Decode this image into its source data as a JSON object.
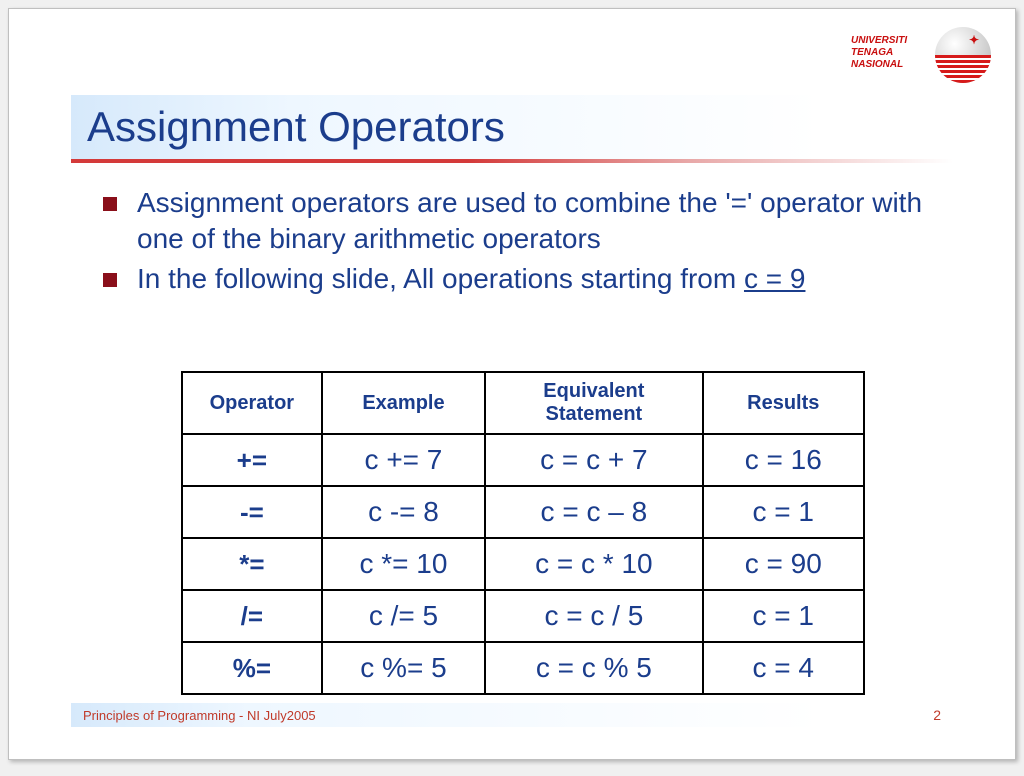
{
  "logo": {
    "line1": "UNIVERSITI",
    "line2": "TENAGA",
    "line3": "NASIONAL"
  },
  "title": "Assignment Operators",
  "bullets": [
    {
      "text": "Assignment operators are used to combine the '=' operator with one of the binary arithmetic operators"
    },
    {
      "text": "In the following slide, All operations starting from ",
      "tail_underlined": "c = 9"
    }
  ],
  "table": {
    "headers": [
      "Operator",
      "Example",
      "Equivalent Statement",
      "Results"
    ],
    "rows": [
      {
        "operator": "+=",
        "example": "c += 7",
        "equivalent": "c = c + 7",
        "result": "c = 16"
      },
      {
        "operator": "-=",
        "example": "c -= 8",
        "equivalent": "c = c – 8",
        "result": "c = 1"
      },
      {
        "operator": "*=",
        "example": "c *= 10",
        "equivalent": "c = c * 10",
        "result": "c = 90"
      },
      {
        "operator": "/=",
        "example": "c /= 5",
        "equivalent": "c = c / 5",
        "result": "c = 1"
      },
      {
        "operator": "%=",
        "example": "c %= 5",
        "equivalent": "c = c % 5",
        "result": "c = 4"
      }
    ]
  },
  "footer": "Principles of Programming - NI July2005",
  "page_number": "2",
  "chart_data": {
    "type": "table",
    "title": "Assignment Operators (starting from c = 9)",
    "columns": [
      "Operator",
      "Example",
      "Equivalent Statement",
      "Results"
    ],
    "rows": [
      [
        "+=",
        "c += 7",
        "c = c + 7",
        "c = 16"
      ],
      [
        "-=",
        "c -= 8",
        "c = c - 8",
        "c = 1"
      ],
      [
        "*=",
        "c *= 10",
        "c = c * 10",
        "c = 90"
      ],
      [
        "/=",
        "c /= 5",
        "c = c / 5",
        "c = 1"
      ],
      [
        "%=",
        "c %= 5",
        "c = c % 5",
        "c = 4"
      ]
    ]
  }
}
